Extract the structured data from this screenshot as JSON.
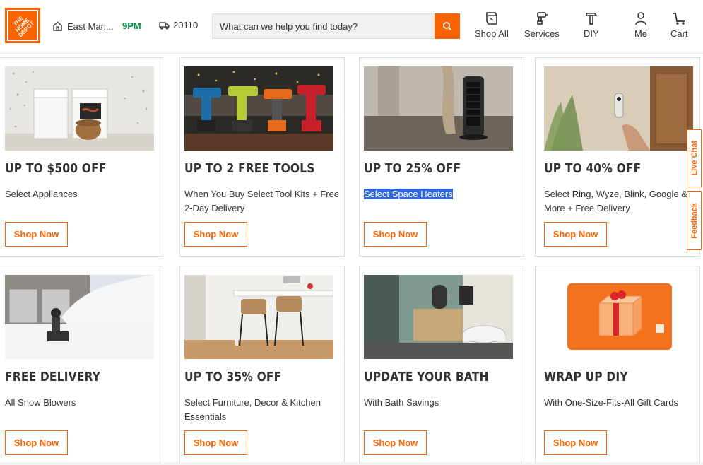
{
  "header": {
    "logo_text": "THE\nHOME\nDEPOT",
    "store_name": "East Man...",
    "store_hours": "9PM",
    "zip": "20110",
    "search_placeholder": "What can we help you find today?",
    "nav": [
      {
        "label": "Shop All",
        "icon": "shop-all-icon"
      },
      {
        "label": "Services",
        "icon": "drill-icon"
      },
      {
        "label": "DIY",
        "icon": "hammer-icon"
      },
      {
        "label": "Me",
        "icon": "user-icon"
      },
      {
        "label": "Cart",
        "icon": "cart-icon"
      }
    ]
  },
  "cards": [
    {
      "title": "UP TO $500 OFF",
      "desc": "Select Appliances",
      "button": "Shop Now",
      "image": "washer-dryer-image"
    },
    {
      "title": "UP TO 2 FREE TOOLS",
      "desc": "When You Buy Select Tool Kits + Free 2-Day Delivery",
      "button": "Shop Now",
      "image": "power-drills-image"
    },
    {
      "title": "UP TO 25% OFF",
      "desc": "Select Space Heaters",
      "button": "Shop Now",
      "image": "space-heater-image"
    },
    {
      "title": "UP TO 40% OFF",
      "desc": "Select Ring, Wyze, Blink, Google & More + Free Delivery",
      "button": "Shop Now",
      "image": "video-doorbell-image"
    },
    {
      "title": "FREE DELIVERY",
      "desc": "All Snow Blowers",
      "button": "Shop Now",
      "image": "snow-blower-image"
    },
    {
      "title": "UP TO 35% OFF",
      "desc": "Select Furniture, Decor & Kitchen Essentials",
      "button": "Shop Now",
      "image": "bar-stools-image"
    },
    {
      "title": "UPDATE YOUR BATH",
      "desc": "With Bath Savings",
      "button": "Shop Now",
      "image": "bathroom-image"
    },
    {
      "title": "WRAP UP DIY",
      "desc": "With One-Size-Fits-All Gift Cards",
      "button": "Shop Now",
      "image": "gift-card-image"
    }
  ],
  "side_tabs": {
    "live_chat": "Live Chat",
    "feedback": "Feedback"
  },
  "colors": {
    "brand": "#f96302",
    "hours_green": "#00873c",
    "highlight": "#3367d6"
  }
}
